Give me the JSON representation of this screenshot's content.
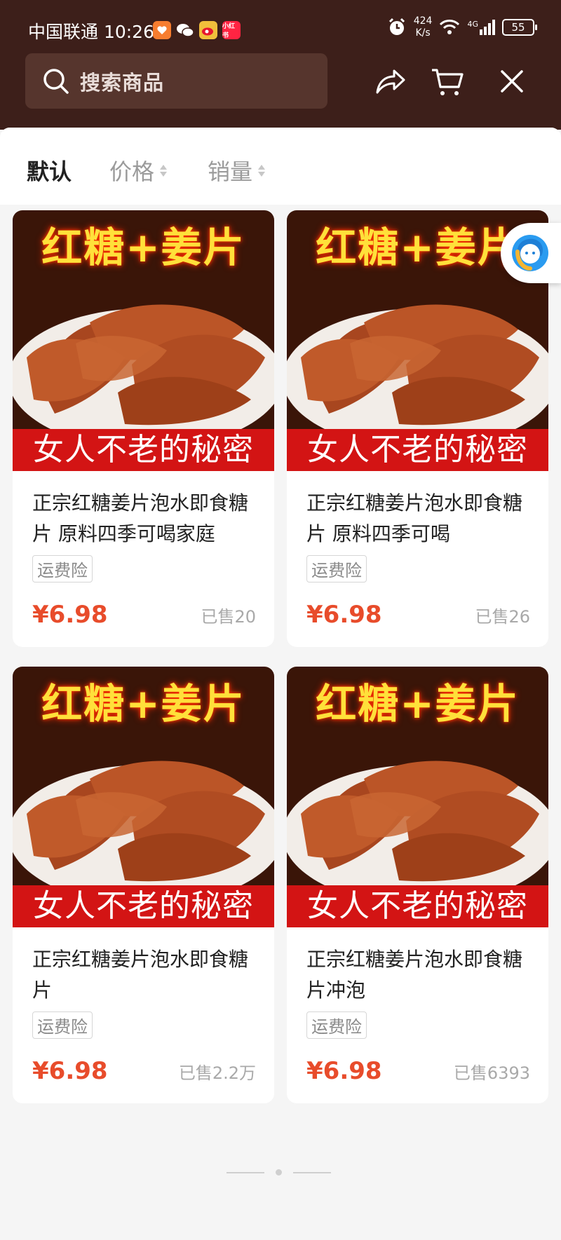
{
  "status_bar": {
    "carrier_time": "中国联通 10:26",
    "app_icons": [
      {
        "name": "taobao-icon",
        "label": "",
        "color": "#f77d2f"
      },
      {
        "name": "wechat-icon",
        "label": "",
        "color": "#3d1f1a"
      },
      {
        "name": "weibo-icon",
        "label": "",
        "color": "#f1bf3b"
      },
      {
        "name": "xiaohongshu-icon",
        "label": "小红书",
        "color": "#ff2442"
      }
    ],
    "net_speed_value": "424",
    "net_speed_unit": "K/s",
    "network": "4G",
    "battery": "55"
  },
  "header": {
    "search_placeholder": "搜索商品",
    "actions": [
      "share-icon",
      "cart-icon",
      "close-icon"
    ]
  },
  "sort_tabs": [
    {
      "label": "默认",
      "active": true
    },
    {
      "label": "价格",
      "active": false
    },
    {
      "label": "销量",
      "active": false
    }
  ],
  "products": [
    {
      "image_title": "红糖+姜片",
      "image_banner": "女人不老的秘密",
      "title": "正宗红糖姜片泡水即食糖片 原料四季可喝家庭",
      "badge": "运费险",
      "price": "¥6.98",
      "sold": "已售20"
    },
    {
      "image_title": "红糖+姜片",
      "image_banner": "女人不老的秘密",
      "title": "正宗红糖姜片泡水即食糖片 原料四季可喝",
      "badge": "运费险",
      "price": "¥6.98",
      "sold": "已售26"
    },
    {
      "image_title": "红糖+姜片",
      "image_banner": "女人不老的秘密",
      "title": "正宗红糖姜片泡水即食糖片",
      "badge": "运费险",
      "price": "¥6.98",
      "sold": "已售2.2万"
    },
    {
      "image_title": "红糖+姜片",
      "image_banner": "女人不老的秘密",
      "title": "正宗红糖姜片泡水即食糖片冲泡",
      "badge": "运费险",
      "price": "¥6.98",
      "sold": "已售6393"
    }
  ],
  "colors": {
    "header_bg": "#3d1f1a",
    "price": "#e84c2b",
    "banner_red": "#d31414",
    "image_title_yellow": "#ffe03a"
  },
  "floating_button": {
    "icon": "customer-service-icon"
  }
}
